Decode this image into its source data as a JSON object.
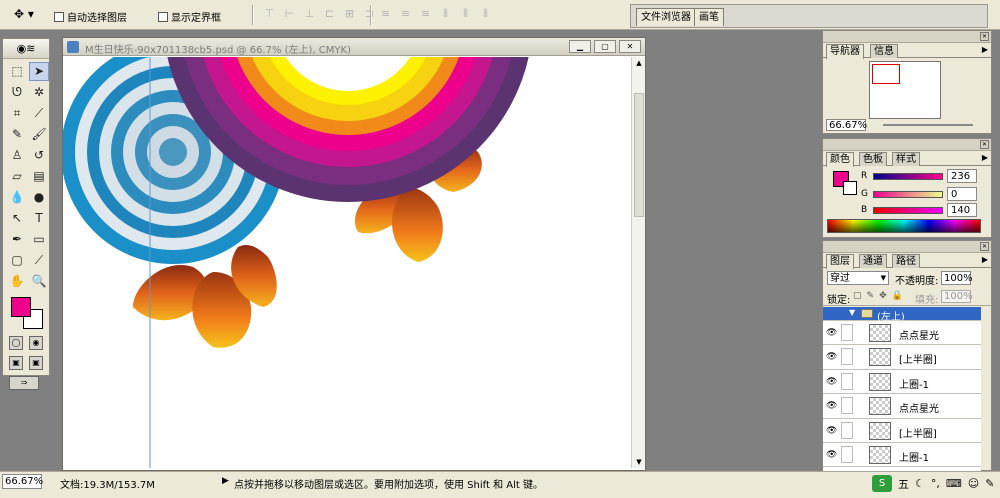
{
  "options_bar": {
    "auto_select_label": "自动选择图层",
    "show_bounds_label": "显示定界框",
    "dock_tabs": [
      "文件浏览器",
      "画笔"
    ]
  },
  "toolbox": {
    "tools": [
      "marquee",
      "move",
      "lasso",
      "magic-wand",
      "crop",
      "slice",
      "healing",
      "brush",
      "stamp",
      "history-brush",
      "eraser",
      "gradient",
      "blur",
      "dodge",
      "path-select",
      "type",
      "pen",
      "shape",
      "notes",
      "eyedropper",
      "hand",
      "zoom"
    ],
    "foreground_color": "#ec008c",
    "background_color": "#ffffff"
  },
  "document": {
    "title": "M生日快乐-90x701138cb5.psd @ 66.7% (左上), CMYK)"
  },
  "navigator": {
    "tabs": [
      "导航器",
      "信息"
    ],
    "zoom": "66.67%"
  },
  "color_panel": {
    "tabs": [
      "颜色",
      "色板",
      "样式"
    ],
    "r_label": "R",
    "r_value": "236",
    "g_label": "G",
    "g_value": "0",
    "b_label": "B",
    "b_value": "140",
    "color_hex": "#ec008c"
  },
  "layers_panel": {
    "tabs": [
      "图层",
      "通道",
      "路径"
    ],
    "blend_mode": "穿过",
    "opacity_label": "不透明度:",
    "opacity_value": "100%",
    "lock_label": "锁定:",
    "fill_label": "填充:",
    "fill_value": "100%",
    "group_name": "(左上)",
    "layers": [
      "点点星光",
      "[上半圈]",
      "上圈-1",
      "点点星光",
      "[上半圈]",
      "上圈-1"
    ]
  },
  "status_bar": {
    "zoom": "66.67%",
    "doc_size": "文档:19.3M/153.7M",
    "tip": "点按并拖移以移动图层或选区。要用附加选项，使用 Shift 和 Alt 键。",
    "ime_label": "五"
  }
}
